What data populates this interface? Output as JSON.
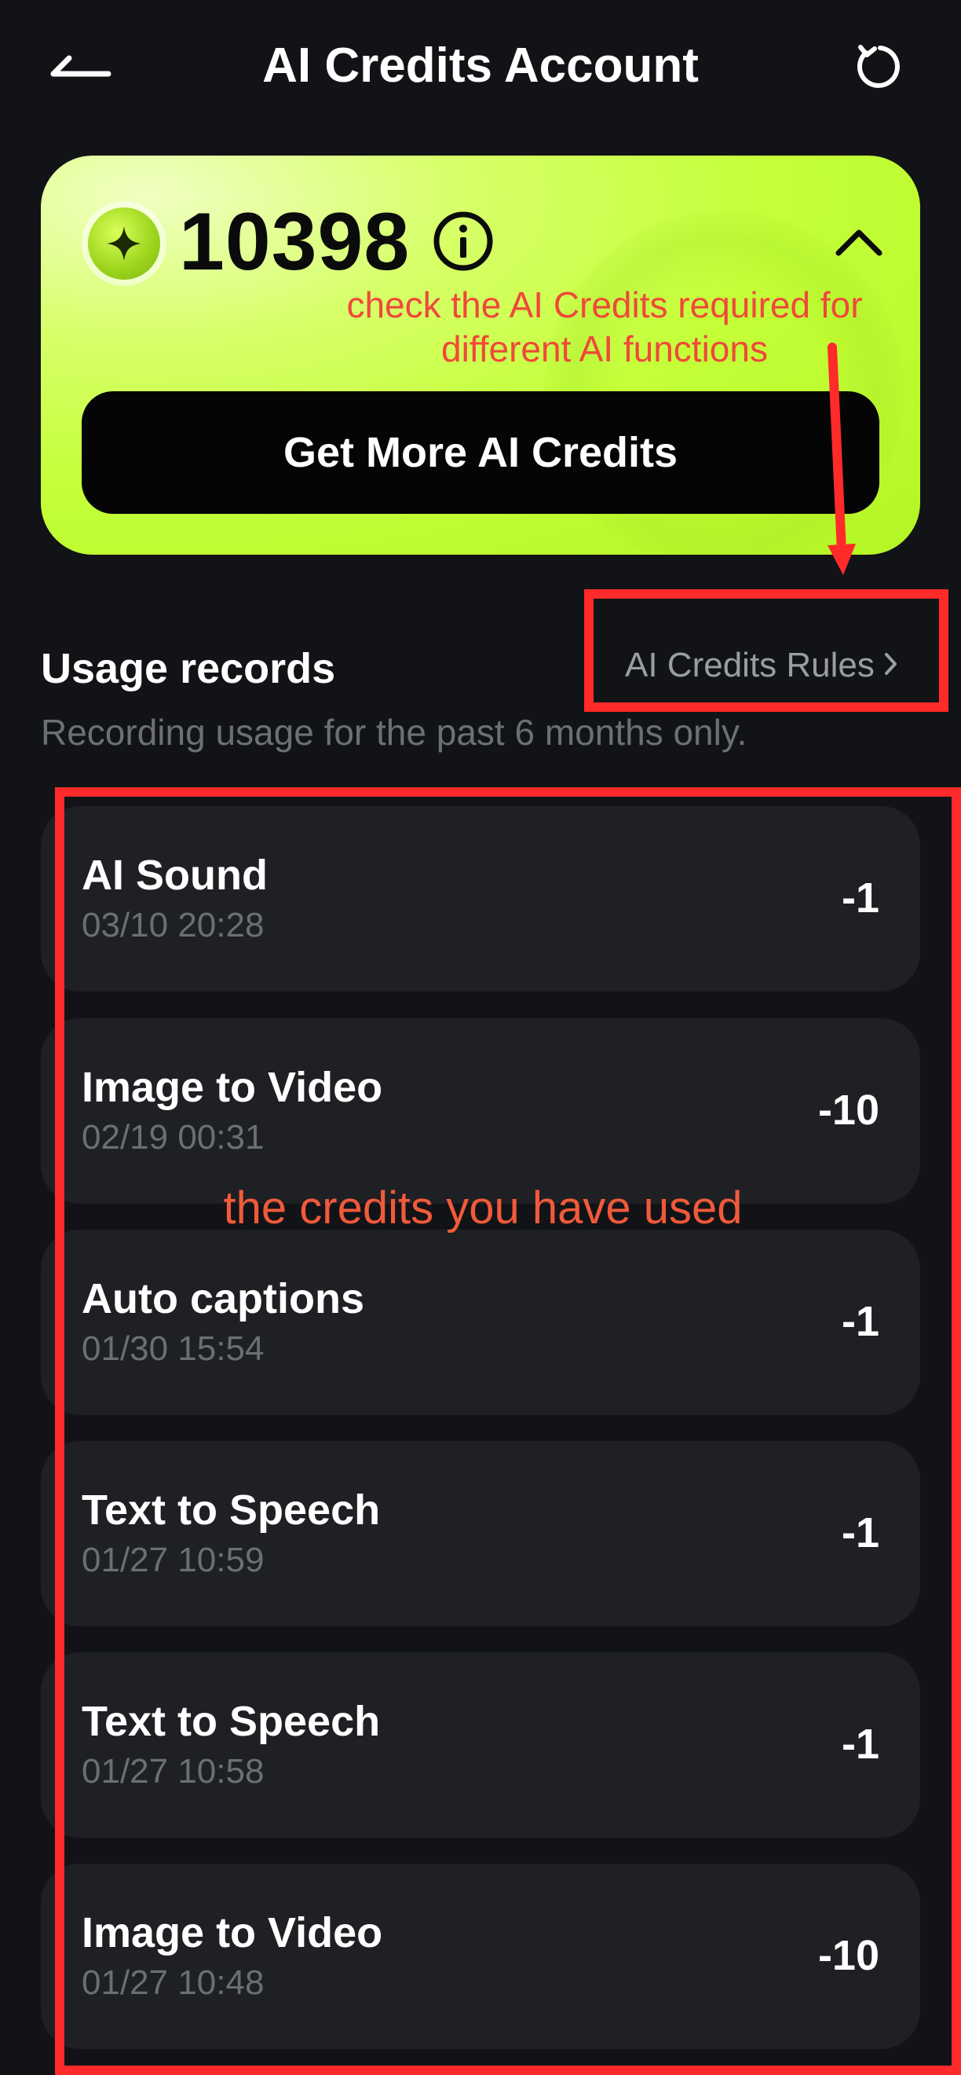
{
  "header": {
    "title": "AI Credits Account",
    "back_icon": "back-arrow-icon",
    "refresh_icon": "refresh-icon"
  },
  "balance": {
    "value": "10398",
    "coin_icon": "sparkle-coin-icon",
    "info_icon": "info-icon",
    "collapse_icon": "chevron-up-icon",
    "get_more_label": "Get More AI Credits"
  },
  "usage": {
    "title": "Usage records",
    "subtitle": "Recording usage for the past 6 months only.",
    "rules_link": "AI Credits Rules",
    "records": [
      {
        "name": "AI Sound",
        "time": "03/10 20:28",
        "credit": "-1"
      },
      {
        "name": "Image to Video",
        "time": "02/19 00:31",
        "credit": "-10"
      },
      {
        "name": "Auto captions",
        "time": "01/30 15:54",
        "credit": "-1"
      },
      {
        "name": "Text to Speech",
        "time": "01/27 10:59",
        "credit": "-1"
      },
      {
        "name": "Text to Speech",
        "time": "01/27 10:58",
        "credit": "-1"
      },
      {
        "name": "Image to Video",
        "time": "01/27 10:48",
        "credit": "-10"
      }
    ]
  },
  "annotations": {
    "rules_note_line1": "check the AI Credits required for",
    "rules_note_line2": "different AI functions",
    "records_note": "the credits you have used"
  },
  "colors": {
    "background": "#121316",
    "card_accent": "#c4ff38",
    "record_bg": "#1e2024",
    "annotation": "#ff2a2a"
  }
}
